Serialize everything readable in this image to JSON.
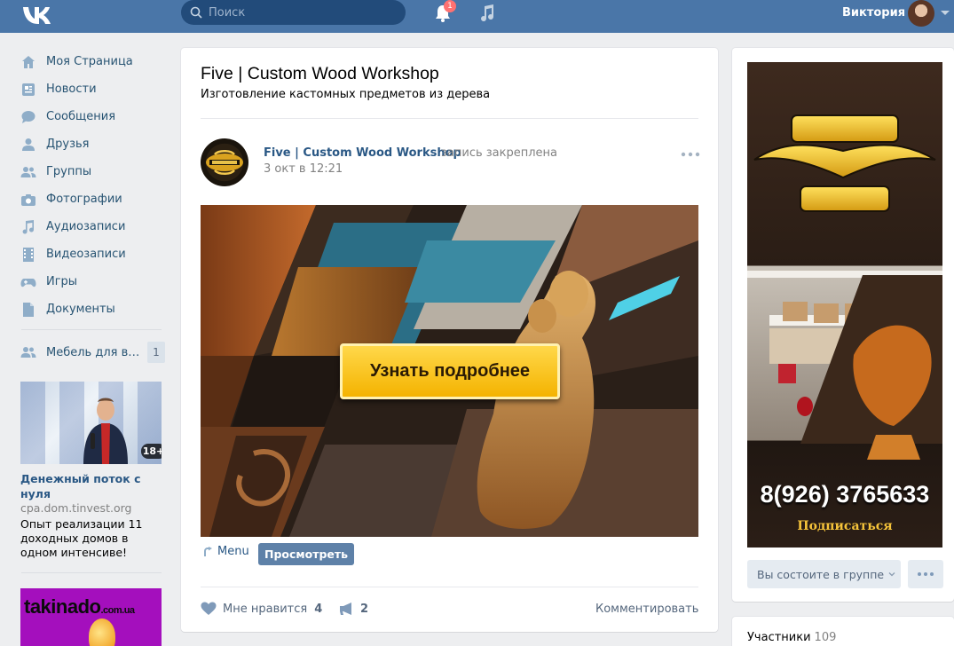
{
  "header": {
    "search_placeholder": "Поиск",
    "notifications_count": "1",
    "user_name": "Виктория"
  },
  "sidebar": {
    "items": [
      {
        "label": "Моя Страница",
        "icon": "home-icon"
      },
      {
        "label": "Новости",
        "icon": "news-icon"
      },
      {
        "label": "Сообщения",
        "icon": "messages-icon"
      },
      {
        "label": "Друзья",
        "icon": "friend-icon"
      },
      {
        "label": "Группы",
        "icon": "groups-icon"
      },
      {
        "label": "Фотографии",
        "icon": "camera-icon"
      },
      {
        "label": "Аудиозаписи",
        "icon": "music-note-icon"
      },
      {
        "label": "Видеозаписи",
        "icon": "film-icon"
      },
      {
        "label": "Игры",
        "icon": "gamepad-icon"
      },
      {
        "label": "Документы",
        "icon": "document-icon"
      }
    ],
    "group_item": {
      "label": "Мебель для ва...",
      "count": "1"
    }
  },
  "ads": {
    "ad1": {
      "age": "18+",
      "title": "Денежный поток с нуля",
      "domain": "cpa.dom.tinvest.org",
      "description": "Опыт реализации 11 доходных домов в одном интенсиве!"
    },
    "ad2": {
      "logo": "takinado",
      "logo_suffix": ".com.ua"
    }
  },
  "group": {
    "title": "Five | Custom Wood Workshop",
    "subtitle": "Изготовление кастомных предметов из дерева"
  },
  "post": {
    "author": " Five | Custom Wood Workshop",
    "pinned": "запись закреплена",
    "date": "3 окт в 12:21",
    "cta": "Узнать подробнее",
    "menu_label": "Menu",
    "view_button": "Просмотреть",
    "like_label": "Мне нравится",
    "like_count": "4",
    "share_count": "2",
    "comment_label": "Комментировать"
  },
  "right": {
    "phone": "8(926) 3765633",
    "subscribe": "Подписаться",
    "member_button": "Вы состоите в группе",
    "members_label": "Участники",
    "members_count": "109"
  },
  "colors": {
    "header_bg": "#4a76a8",
    "link": "#2a5885",
    "page_bg": "#edeef0",
    "button_bg": "#5e81a8"
  }
}
